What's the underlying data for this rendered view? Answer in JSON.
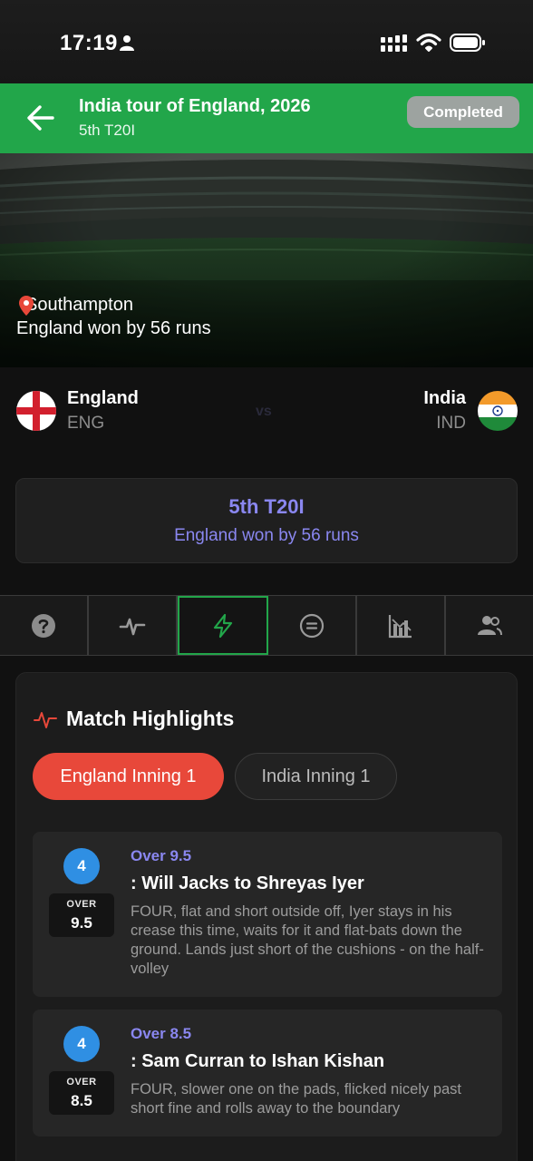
{
  "status_bar": {
    "time": "17:19"
  },
  "header": {
    "title": "India tour of England, 2026",
    "subtitle": "5th T20I",
    "status": "Completed"
  },
  "hero": {
    "venue": "Southampton",
    "result": "England won by 56 runs"
  },
  "teams": {
    "home": {
      "name": "England",
      "code": "ENG"
    },
    "away": {
      "name": "India",
      "code": "IND"
    },
    "vs": "vs"
  },
  "summary": {
    "title": "5th T20I",
    "result": "England won by 56 runs"
  },
  "tabs": [
    {
      "icon": "question-icon",
      "active": false
    },
    {
      "icon": "pulse-icon",
      "active": false
    },
    {
      "icon": "lightning-icon",
      "active": true
    },
    {
      "icon": "equals-circle-icon",
      "active": false
    },
    {
      "icon": "bar-chart-icon",
      "active": false
    },
    {
      "icon": "users-icon",
      "active": false
    }
  ],
  "highlights": {
    "title": "Match Highlights",
    "innings": [
      {
        "label": "England Inning 1",
        "active": true
      },
      {
        "label": "India Inning 1",
        "active": false
      }
    ],
    "balls": [
      {
        "runs": "4",
        "over_label": "OVER",
        "over": "9.5",
        "over_text": "Over 9.5",
        "title": ": Will Jacks to Shreyas Iyer",
        "description": "FOUR, flat and short outside off, Iyer stays in his crease this time, waits for it and flat-bats down the ground. Lands just short of the cushions - on the half-volley"
      },
      {
        "runs": "4",
        "over_label": "OVER",
        "over": "8.5",
        "over_text": "Over 8.5",
        "title": ": Sam Curran to Ishan Kishan",
        "description": "FOUR, slower one on the pads, flicked nicely past short fine and rolls away to the boundary"
      }
    ]
  },
  "colors": {
    "header_green": "#22a64a",
    "accent_purple": "#8a87f0",
    "active_inning": "#e8483a",
    "boundary_blue": "#2f8fe3"
  }
}
